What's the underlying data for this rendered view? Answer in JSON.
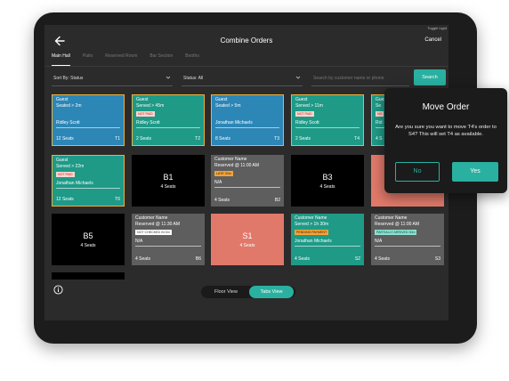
{
  "toggle_label": "Toggle Light",
  "header": {
    "title": "Combine Orders",
    "cancel": "Cancel"
  },
  "tabs": [
    {
      "label": "Main Hall",
      "active": true
    },
    {
      "label": "Patio"
    },
    {
      "label": "Reserved Room"
    },
    {
      "label": "Bar Section"
    },
    {
      "label": "Booths"
    }
  ],
  "filters": {
    "sort": "Sort By: Status",
    "status": "Status: All"
  },
  "search": {
    "placeholder": "Search by customer name or phone",
    "button": "Search"
  },
  "tables": [
    {
      "kind": "order",
      "color": "blue",
      "selected": true,
      "line1": "Guest",
      "line2": "Seated > 2m",
      "name": "Ridley Scott",
      "seats": "12 Seats",
      "code": "T1"
    },
    {
      "kind": "order",
      "color": "teal",
      "selected": true,
      "line1": "Guest",
      "line2": "Served > 45m",
      "badge": {
        "text": "NOT PAID",
        "style": "red"
      },
      "name": "Ridley Scott",
      "seats": "2 Seats",
      "code": "T2"
    },
    {
      "kind": "order",
      "color": "blue",
      "selected": true,
      "line1": "Guest",
      "line2": "Seated > 5m",
      "name": "Jonathan Michaels",
      "seats": "8 Seats",
      "code": "T3"
    },
    {
      "kind": "order",
      "color": "teal",
      "selected": true,
      "line1": "Guest",
      "line2": "Served > 11m",
      "badge": {
        "text": "NOT PAID",
        "style": "red"
      },
      "name": "Ridley Scott",
      "seats": "2 Seats",
      "code": "T4"
    },
    {
      "kind": "order",
      "color": "teal",
      "selected": true,
      "line1": "Guest",
      "line2": "Se",
      "badge": {
        "text": "NO",
        "style": "red"
      },
      "name": "Rid",
      "seats": "4 S",
      "code": ""
    },
    {
      "kind": "order",
      "color": "teal",
      "selected": true,
      "line1": "Guest",
      "line2": "Served > 22m",
      "badge": {
        "text": "NOT PAID",
        "style": "red"
      },
      "name": "Jonathan Michaels",
      "seats": "12 Seats",
      "code": "T6"
    },
    {
      "kind": "empty",
      "color": "black",
      "label": "B1",
      "seats": "4 Seats"
    },
    {
      "kind": "order",
      "color": "gray",
      "line1": "Customer Name",
      "line2": "Reserved @ 11:00 AM",
      "badge": {
        "text": "LATE 30m",
        "style": "orange"
      },
      "name": "N/A",
      "seats": "4 Seats",
      "code": "B2"
    },
    {
      "kind": "empty",
      "color": "black",
      "label": "B3",
      "seats": "4 Seats"
    },
    {
      "kind": "empty",
      "color": "salmon",
      "label": "",
      "seats": ""
    },
    {
      "kind": "empty",
      "color": "black",
      "label": "B5",
      "seats": "4 Seats"
    },
    {
      "kind": "order",
      "color": "gray",
      "line1": "Customer Name",
      "line2": "Reserved @ 11:30 AM",
      "badge": {
        "text": "NOT CHECKED IN 0m",
        "style": "white"
      },
      "name": "N/A",
      "seats": "4 Seats",
      "code": "B6"
    },
    {
      "kind": "empty",
      "color": "salmon",
      "label": "S1",
      "seats": "4 Seats"
    },
    {
      "kind": "order",
      "color": "teal",
      "line1": "Customer Name",
      "line2": "Served > 1h 30m",
      "badge": {
        "text": "PENDING PAYMENT",
        "style": "orange"
      },
      "name": "Jonathan Michaels",
      "seats": "4 Seats",
      "code": "S2"
    },
    {
      "kind": "order",
      "color": "gray",
      "line1": "Customer Name",
      "line2": "Reserved @ 11:00 AM",
      "badge": {
        "text": "PARTIALLY ARRIVED 30m",
        "style": "teal"
      },
      "name": "N/A",
      "seats": "4 Seats",
      "code": "S3"
    }
  ],
  "view_toggle": {
    "floor": "Floor View",
    "tabs": "Tabs View",
    "active": "tabs"
  },
  "modal": {
    "title": "Move Order",
    "body": "Are you sure you want to move T4's order to S4? This will set T4 as available.",
    "no": "No",
    "yes": "Yes"
  },
  "colors": {
    "accent": "#2ab0a0",
    "blue": "#2c86b6",
    "teal": "#1e9a87",
    "salmon": "#e0796a",
    "gray": "#5e5e5e",
    "selected_border": "#e8b340"
  }
}
